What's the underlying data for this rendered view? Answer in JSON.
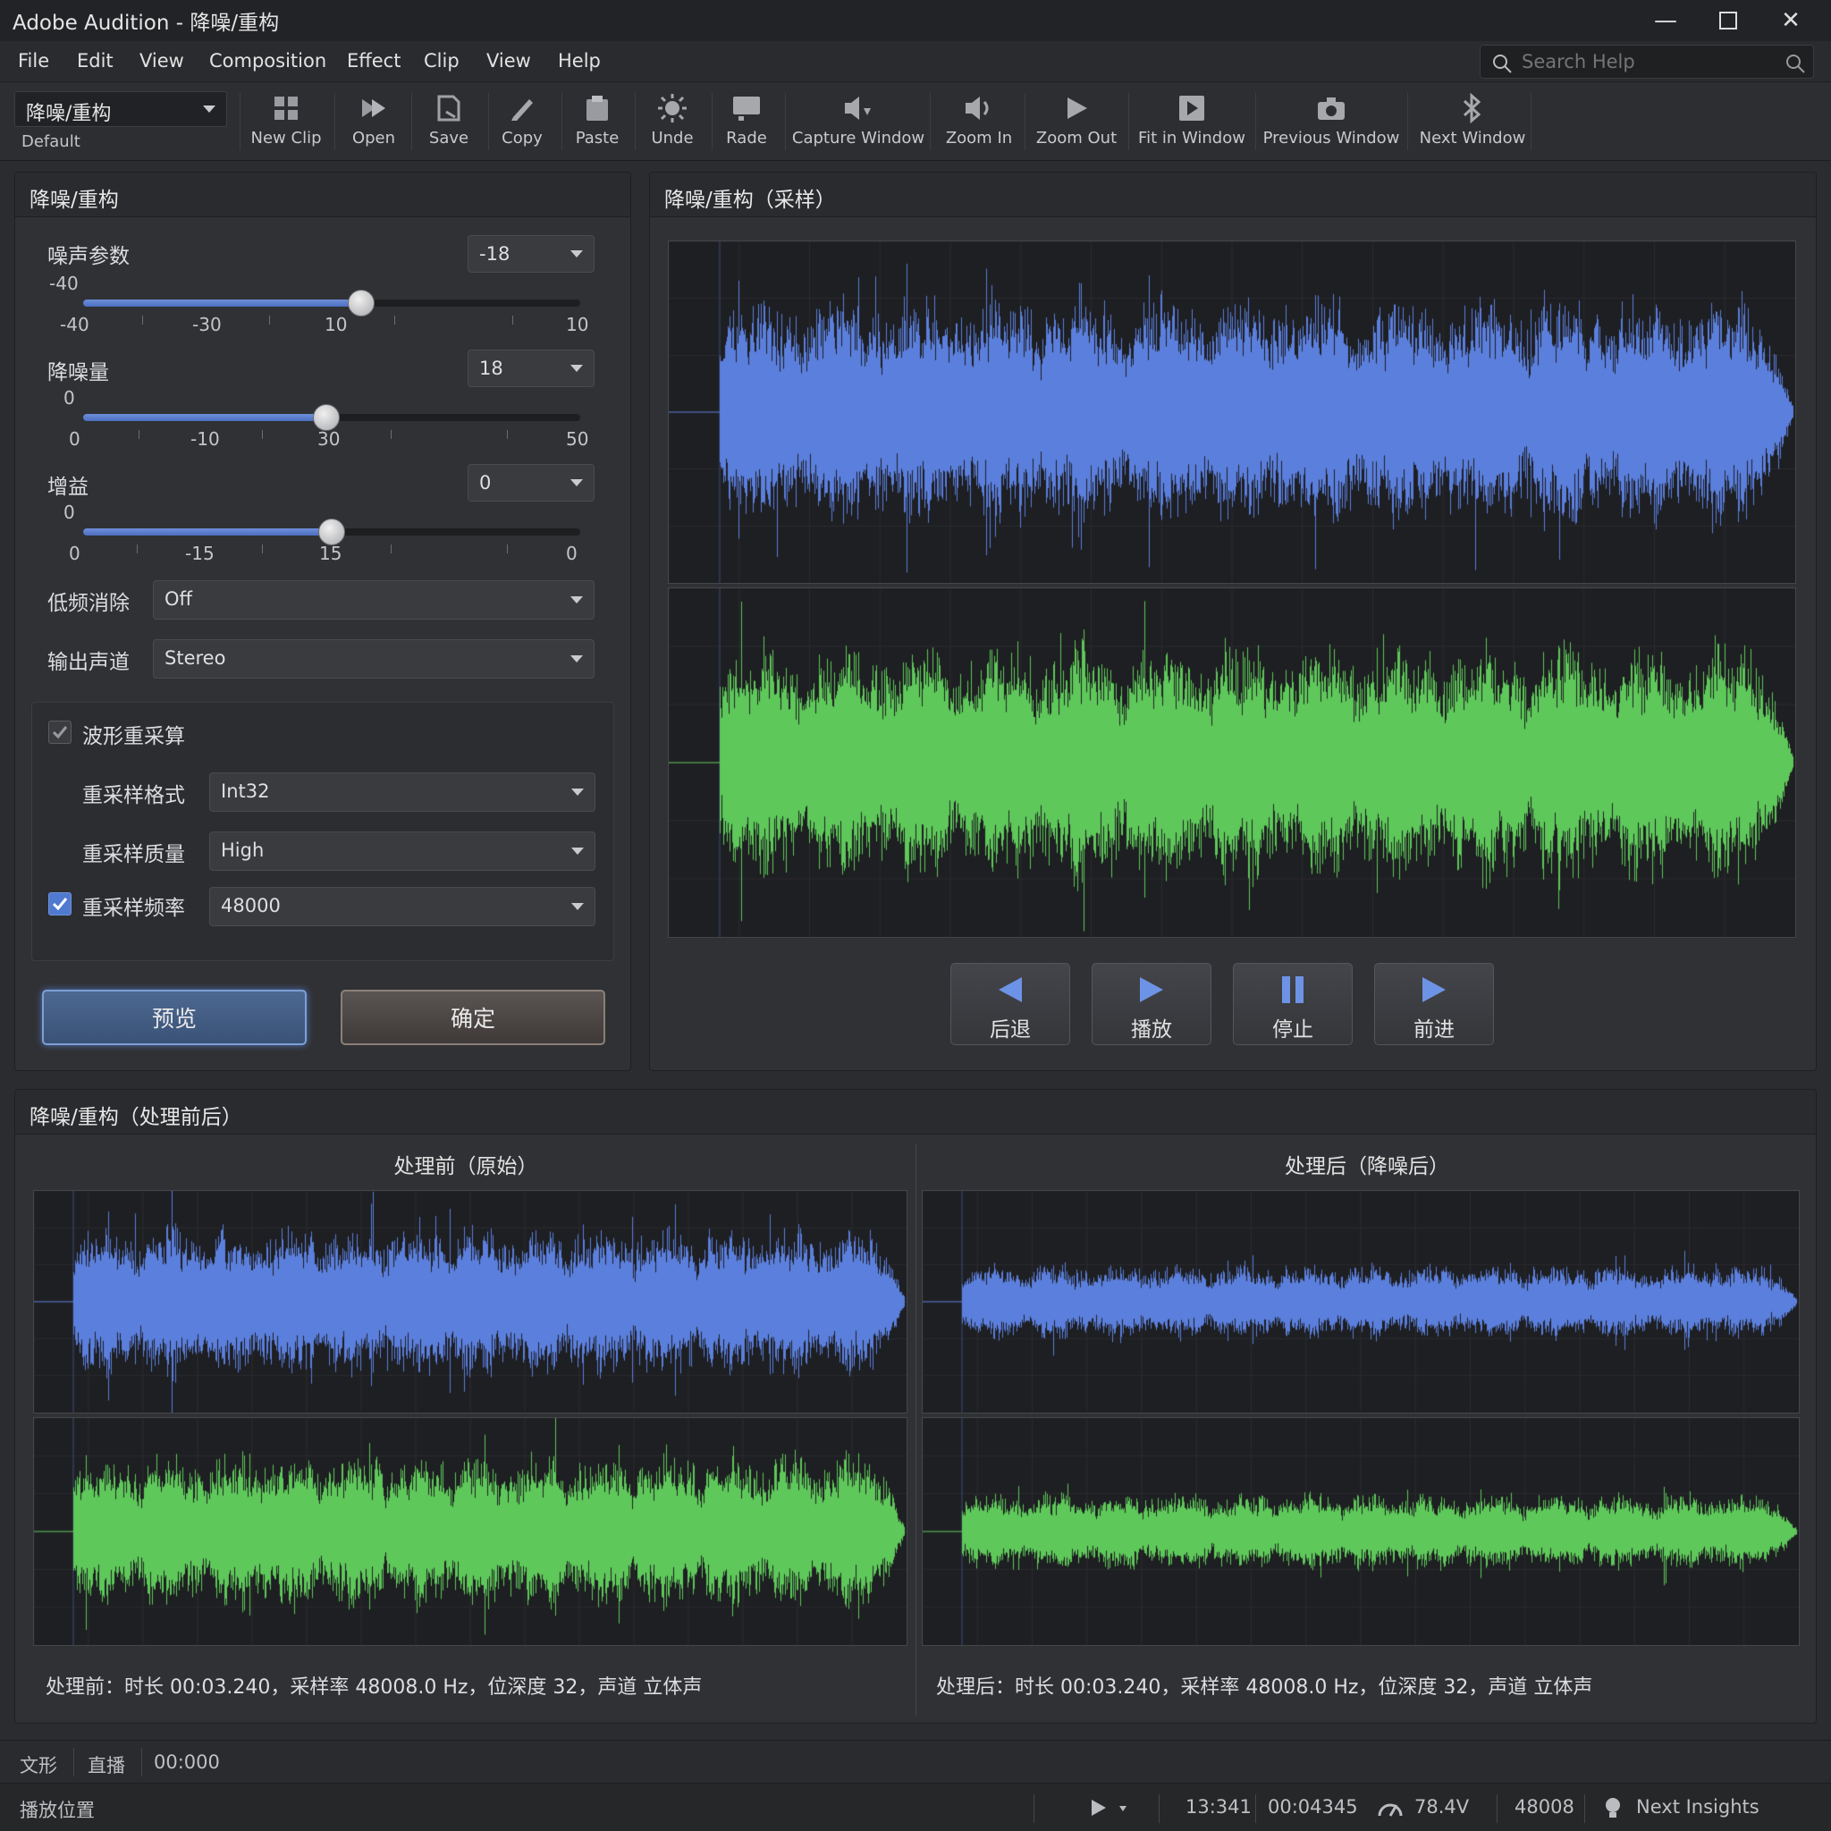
{
  "window": {
    "title": "Adobe Audition - 降噪/重构"
  },
  "menu": [
    "File",
    "Edit",
    "View",
    "Composition",
    "Effect",
    "Clip",
    "View",
    "Help"
  ],
  "search": {
    "placeholder": "Search Help"
  },
  "toolbar": {
    "preset": "降噪/重构",
    "workspace": "Default",
    "buttons": [
      "New Clip",
      "Open",
      "Save",
      "Copy",
      "Paste",
      "Unde",
      "Rade",
      "Capture Window",
      "Zoom In",
      "Zoom Out",
      "Fit in Window",
      "Previous Window",
      "Next Window"
    ]
  },
  "effect_panel": {
    "title": "降噪/重构",
    "noise_param": {
      "label": "噪声参数",
      "value": "-18",
      "current": "-40",
      "ticks": [
        "-40",
        "-30",
        "10",
        "10"
      ],
      "level": 0.56
    },
    "reduction": {
      "label": "降噪量",
      "value": "18",
      "current": "0",
      "ticks": [
        "0",
        "-10",
        "30",
        "50"
      ],
      "level": 0.49
    },
    "gain": {
      "label": "增益",
      "value": "0",
      "current": "0",
      "ticks": [
        "0",
        "-15",
        "15",
        "0"
      ],
      "level": 0.5
    },
    "lowcut": {
      "label": "低频消除",
      "value": "Off"
    },
    "output": {
      "label": "输出声道",
      "value": "Stereo"
    },
    "resample": {
      "label": "波形重采算",
      "format_label": "重采样格式",
      "format": "Int32",
      "quality_label": "重采样质量",
      "quality": "High",
      "rate_label": "重采样频率",
      "rate": "48000"
    },
    "preview_button": "预览",
    "ok_button": "确定"
  },
  "sample_panel": {
    "title": "降噪/重构（采样）",
    "transport": [
      "后退",
      "播放",
      "停止",
      "前进"
    ]
  },
  "compare_panel": {
    "title": "降噪/重构（处理前后）",
    "before_title": "处理前（原始）",
    "after_title": "处理后（降噪后）",
    "before_info": "处理前：时长 00:03.240，采样率 48008.0 Hz，位深度 32，声道 立体声",
    "after_info": "处理后：时长 00:03.240，采样率 48008.0 Hz，位深度 32，声道 立体声"
  },
  "status1": {
    "a": "文形",
    "b": "直播",
    "time": "00:000"
  },
  "status2": {
    "label": "播放位置",
    "t1": "13:341",
    "t2": "00:04345",
    "vol": "78.4V",
    "rate": "48008",
    "hint": "Next Insights"
  },
  "colors": {
    "left_channel": "#5b7fdc",
    "right_channel": "#5ec85a"
  }
}
